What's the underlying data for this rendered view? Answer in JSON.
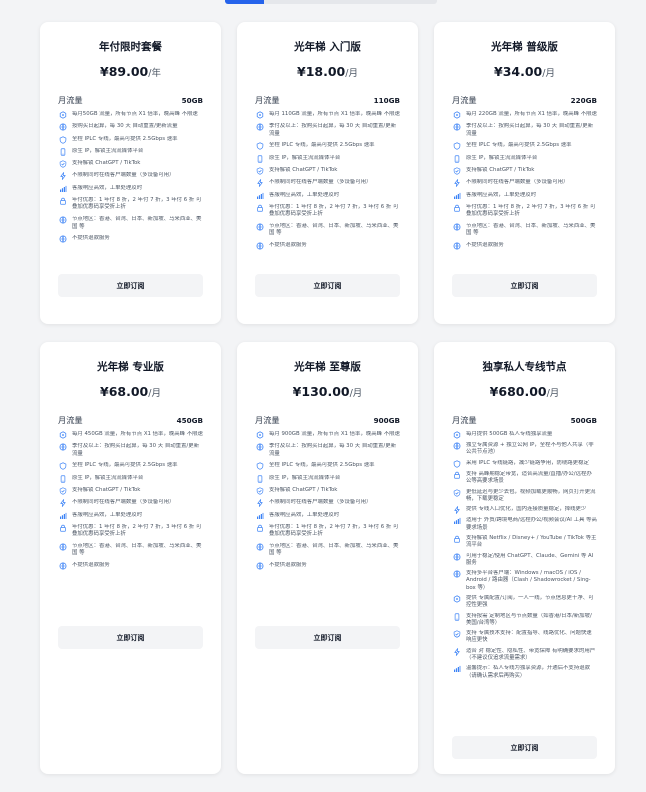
{
  "colors": {
    "accent": "#2563eb",
    "icon": "#3b82f6",
    "background": "#f3f4f6",
    "card": "#ffffff"
  },
  "traffic_label": "月流量",
  "cards": [
    {
      "name": "年付限时套餐",
      "price": "¥89.00",
      "unit": "/年",
      "traffic": "50GB",
      "button": "立即订阅",
      "features": [
        {
          "icon": "server-icon",
          "text": "每月50GB 流量，所有节点 X1 倍率，晚高峰 不限速"
        },
        {
          "icon": "globe-icon",
          "text": "按购买日起算，每 30 天 自动重置/更新流量"
        },
        {
          "icon": "shield-icon",
          "text": "全程 IPLC 专线，最高可提供 2.5Gbps 速率"
        },
        {
          "icon": "phone-icon",
          "text": "原生 IP，解锁主流流媒体平台"
        },
        {
          "icon": "check-shield-icon",
          "text": "支持解锁 ChatGPT / TikTok"
        },
        {
          "icon": "lightning-icon",
          "text": "不限制同时在线客户端数量（多设备可用）"
        },
        {
          "icon": "bar-chart-icon",
          "text": "客服响应高效，工单处理及时"
        },
        {
          "icon": "lock-icon",
          "text": "年付优惠：1 年付 8 折，2 年付 7 折，3 年付 6 折 可叠加优惠码享受折上折"
        },
        {
          "icon": "globe-icon",
          "text": "节点地区：香港、台湾、日本、新加坡、马来西亚、美国 等"
        },
        {
          "icon": "globe-icon",
          "text": "不提供退款服务"
        }
      ]
    },
    {
      "name": "光年梯 入门版",
      "price": "¥18.00",
      "unit": "/月",
      "traffic": "110GB",
      "button": "立即订阅",
      "features": [
        {
          "icon": "server-icon",
          "text": "每月 110GB 流量，所有节点 X1 倍率，晚高峰 不限速"
        },
        {
          "icon": "globe-icon",
          "text": "季付及以上：按购买日起算，每 30 天 自动重置/更新流量"
        },
        {
          "icon": "shield-icon",
          "text": "全程 IPLC 专线，最高可提供 2.5Gbps 速率"
        },
        {
          "icon": "phone-icon",
          "text": "原生 IP，解锁主流流媒体平台"
        },
        {
          "icon": "check-shield-icon",
          "text": "支持解锁 ChatGPT / TikTok"
        },
        {
          "icon": "lightning-icon",
          "text": "不限制同时在线客户端数量（多设备可用）"
        },
        {
          "icon": "bar-chart-icon",
          "text": "客服响应高效，工单处理及时"
        },
        {
          "icon": "lock-icon",
          "text": "年付优惠：1 年付 8 折，2 年付 7 折，3 年付 6 折 可叠加优惠码享受折上折"
        },
        {
          "icon": "globe-icon",
          "text": "节点地区：香港、台湾、日本、新加坡、马来西亚、美国 等"
        },
        {
          "icon": "globe-icon",
          "text": "不提供退款服务"
        }
      ]
    },
    {
      "name": "光年梯 普级版",
      "price": "¥34.00",
      "unit": "/月",
      "traffic": "220GB",
      "button": "立即订阅",
      "features": [
        {
          "icon": "server-icon",
          "text": "每月 220GB 流量，所有节点 X1 倍率，晚高峰 不限速"
        },
        {
          "icon": "globe-icon",
          "text": "季付及以上：按购买日起算，每 30 天 自动重置/更新流量"
        },
        {
          "icon": "shield-icon",
          "text": "全程 IPLC 专线，最高可提供 2.5Gbps 速率"
        },
        {
          "icon": "phone-icon",
          "text": "原生 IP，解锁主流流媒体平台"
        },
        {
          "icon": "check-shield-icon",
          "text": "支持解锁 ChatGPT / TikTok"
        },
        {
          "icon": "lightning-icon",
          "text": "不限制同时在线客户端数量（多设备可用）"
        },
        {
          "icon": "bar-chart-icon",
          "text": "客服响应高效，工单处理及时"
        },
        {
          "icon": "lock-icon",
          "text": "年付优惠：1 年付 8 折，2 年付 7 折，3 年付 6 折 可叠加优惠码享受折上折"
        },
        {
          "icon": "globe-icon",
          "text": "节点地区：香港、台湾、日本、新加坡、马来西亚、美国 等"
        },
        {
          "icon": "globe-icon",
          "text": "不提供退款服务"
        }
      ]
    },
    {
      "name": "光年梯 专业版",
      "price": "¥68.00",
      "unit": "/月",
      "traffic": "450GB",
      "button": "立即订阅",
      "features": [
        {
          "icon": "server-icon",
          "text": "每月 450GB 流量，所有节点 X1 倍率，晚高峰 不限速"
        },
        {
          "icon": "globe-icon",
          "text": "季付及以上：按购买日起算，每 30 天 自动重置/更新流量"
        },
        {
          "icon": "shield-icon",
          "text": "全程 IPLC 专线，最高可提供 2.5Gbps 速率"
        },
        {
          "icon": "phone-icon",
          "text": "原生 IP，解锁主流流媒体平台"
        },
        {
          "icon": "check-shield-icon",
          "text": "支持解锁 ChatGPT / TikTok"
        },
        {
          "icon": "lightning-icon",
          "text": "不限制同时在线客户端数量（多设备可用）"
        },
        {
          "icon": "bar-chart-icon",
          "text": "客服响应高效，工单处理及时"
        },
        {
          "icon": "lock-icon",
          "text": "年付优惠：1 年付 8 折，2 年付 7 折，3 年付 6 折 可叠加优惠码享受折上折"
        },
        {
          "icon": "globe-icon",
          "text": "节点地区：香港、台湾、日本、新加坡、马来西亚、美国 等"
        },
        {
          "icon": "globe-icon",
          "text": "不提供退款服务"
        }
      ]
    },
    {
      "name": "光年梯 至尊版",
      "price": "¥130.00",
      "unit": "/月",
      "traffic": "900GB",
      "button": "立即订阅",
      "features": [
        {
          "icon": "server-icon",
          "text": "每月 900GB 流量，所有节点 X1 倍率，晚高峰 不限速"
        },
        {
          "icon": "globe-icon",
          "text": "季付及以上：按购买日起算，每 30 天 自动重置/更新流量"
        },
        {
          "icon": "shield-icon",
          "text": "全程 IPLC 专线，最高可提供 2.5Gbps 速率"
        },
        {
          "icon": "phone-icon",
          "text": "原生 IP，解锁主流流媒体平台"
        },
        {
          "icon": "check-shield-icon",
          "text": "支持解锁 ChatGPT / TikTok"
        },
        {
          "icon": "lightning-icon",
          "text": "不限制同时在线客户端数量（多设备可用）"
        },
        {
          "icon": "bar-chart-icon",
          "text": "客服响应高效，工单处理及时"
        },
        {
          "icon": "lock-icon",
          "text": "年付优惠：1 年付 8 折，2 年付 7 折，3 年付 6 折 可叠加优惠码享受折上折"
        },
        {
          "icon": "globe-icon",
          "text": "节点地区：香港、台湾、日本、新加坡、马来西亚、美国 等"
        },
        {
          "icon": "globe-icon",
          "text": "不提供退款服务"
        }
      ]
    },
    {
      "name": "独享私人专线节点",
      "price": "¥680.00",
      "unit": "/月",
      "traffic": "500GB",
      "button": "立即订阅",
      "features": [
        {
          "icon": "server-icon",
          "text": "每月提供 500GB 私人专线独享流量"
        },
        {
          "icon": "globe-icon",
          "text": "独立专属资源 + 独立公网 IP，全程不与他人共享（非公共节点池）"
        },
        {
          "icon": "shield-icon",
          "text": "采用 IPLC 专线链路，减少链路争用，防绕路更稳定"
        },
        {
          "icon": "lock-icon",
          "text": "支持 高峰期稳定带宽，适合高流量/直播/办公/远程办公等高要求场景"
        },
        {
          "icon": "check-shield-icon",
          "text": "更低延迟与更少丢包，视频加载更顺畅，网页打开更流畅，下载更稳定"
        },
        {
          "icon": "lightning-icon",
          "text": "提供 专线入口优化，国内连接质量稳定，掉线更少"
        },
        {
          "icon": "bar-chart-icon",
          "text": "适用于 外贸/跨境电商/远程办公/视频会议/AI 工具 等高要求场景"
        },
        {
          "icon": "lock-icon",
          "text": "支持解锁 Netflix / Disney+ / YouTube / TikTok 等主流平台"
        },
        {
          "icon": "globe-icon",
          "text": "可用于稳定/使用 ChatGPT、Claude、Gemini 等 AI 服务"
        },
        {
          "icon": "globe-icon",
          "text": "支持多平台客户端：Windows / macOS / iOS / Android / 路由器（Clash / Shadowrocket / Sing-box 等）"
        },
        {
          "icon": "server-icon",
          "text": "提供 专属配置/订阅，一人一线，节点信息更干净、可控性更强"
        },
        {
          "icon": "phone-icon",
          "text": "支持按需 定制地区与节点数量（如香港/日本/新加坡/美国/台湾等）"
        },
        {
          "icon": "check-shield-icon",
          "text": "支持 专属技术支持：配置指导、线路优化、问题快速响应更快"
        },
        {
          "icon": "lightning-icon",
          "text": "适合 对 稳定性、隐私性、带宽保障 有明确要求的用户（不建议仅追求流量需求）"
        },
        {
          "icon": "bar-chart-icon",
          "text": "温馨提示：私人专线为独享资源，开通后不支持退款（请确认需求后再购买）"
        }
      ]
    }
  ]
}
